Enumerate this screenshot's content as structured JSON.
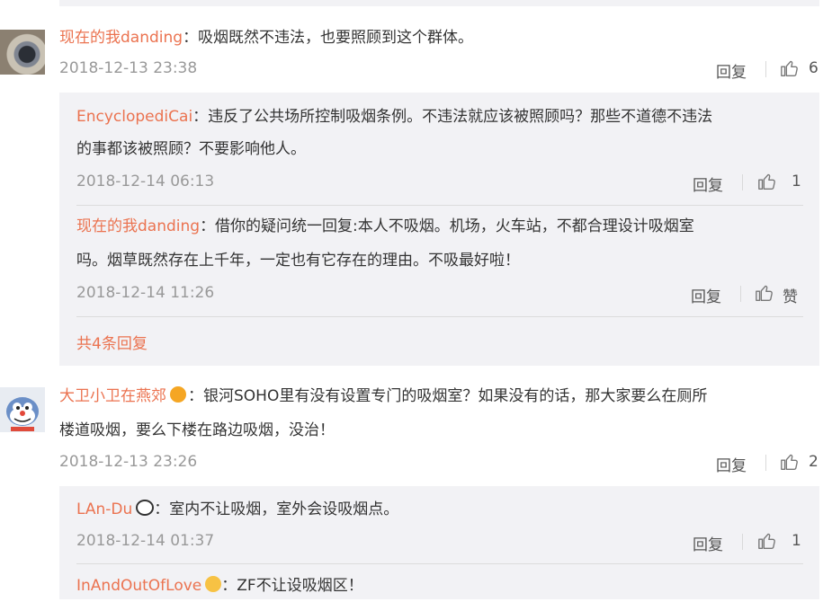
{
  "comments": [
    {
      "user": "现在的我danding",
      "text": "：吸烟既然不违法，也要照顾到这个群体。",
      "date": "2018-12-13 23:38",
      "reply_label": "回复",
      "likes": "6"
    },
    {
      "user": "大卫小卫在燕郊",
      "text_line1": "：银河SOHO里有没有设置专门的吸烟室？如果没有的话，那大家要么在厕所",
      "text_line2": "楼道吸烟，要么下楼在路边吸烟，没治！",
      "date": "2018-12-13 23:26",
      "reply_label": "回复",
      "likes": "2"
    }
  ],
  "replies_1": [
    {
      "user": "EncyclopediCai",
      "text_line1": "：违反了公共场所控制吸烟条例。不违法就应该被照顾吗？那些不道德不违法",
      "text_line2": "的事都该被照顾？不要影响他人。",
      "date": "2018-12-14 06:13",
      "reply_label": "回复",
      "likes": "1"
    },
    {
      "user": "现在的我danding",
      "text_line1": "：借你的疑问统一回复:本人不吸烟。机场，火车站，不都合理设计吸烟室",
      "text_line2": "吗。烟草既然存在上千年，一定也有它存在的理由。不吸最好啦！",
      "date": "2018-12-14 11:26",
      "reply_label": "回复",
      "likes": "赞"
    }
  ],
  "more_replies_1": "共4条回复",
  "replies_2": [
    {
      "user": "LAn-Du",
      "text": "：室内不让吸烟，室外会设吸烟点。",
      "date": "2018-12-14 01:37",
      "reply_label": "回复",
      "likes": "1"
    },
    {
      "user": "InAndOutOfLove",
      "text": "：ZF不让设吸烟区！"
    }
  ],
  "icons": {
    "like": "thumbs-up-icon",
    "avatar1": "user-avatar",
    "avatar2": "user-avatar-cartoon"
  },
  "colors": {
    "username": "#eb7350",
    "reply_box_bg": "#f2f2f5",
    "date": "#999999"
  }
}
